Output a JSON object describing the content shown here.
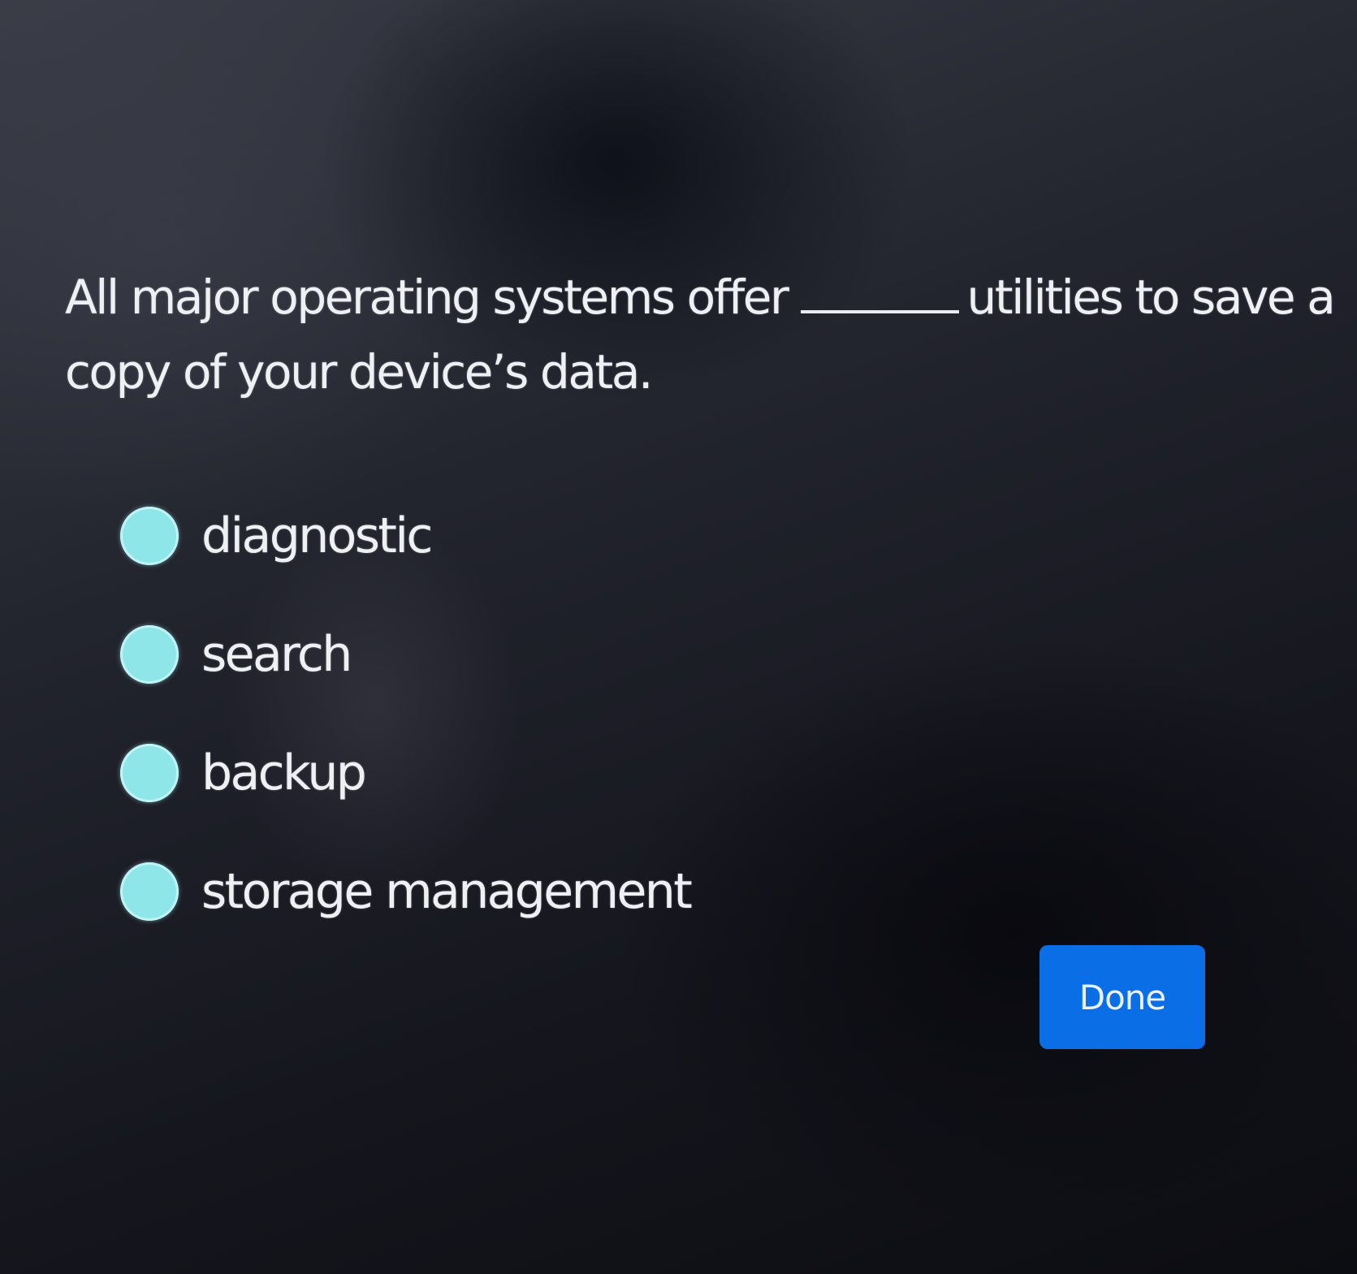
{
  "question": {
    "text_before": "All major operating systems offer",
    "text_after": "utilities to save a copy of your device’s data."
  },
  "options": [
    {
      "label": "diagnostic"
    },
    {
      "label": "search"
    },
    {
      "label": "backup"
    },
    {
      "label": "storage management"
    }
  ],
  "actions": {
    "done_label": "Done"
  },
  "colors": {
    "radio_fill": "#8fe6e9",
    "button_blue": "#0a6fe6",
    "text": "#eef1f4"
  }
}
